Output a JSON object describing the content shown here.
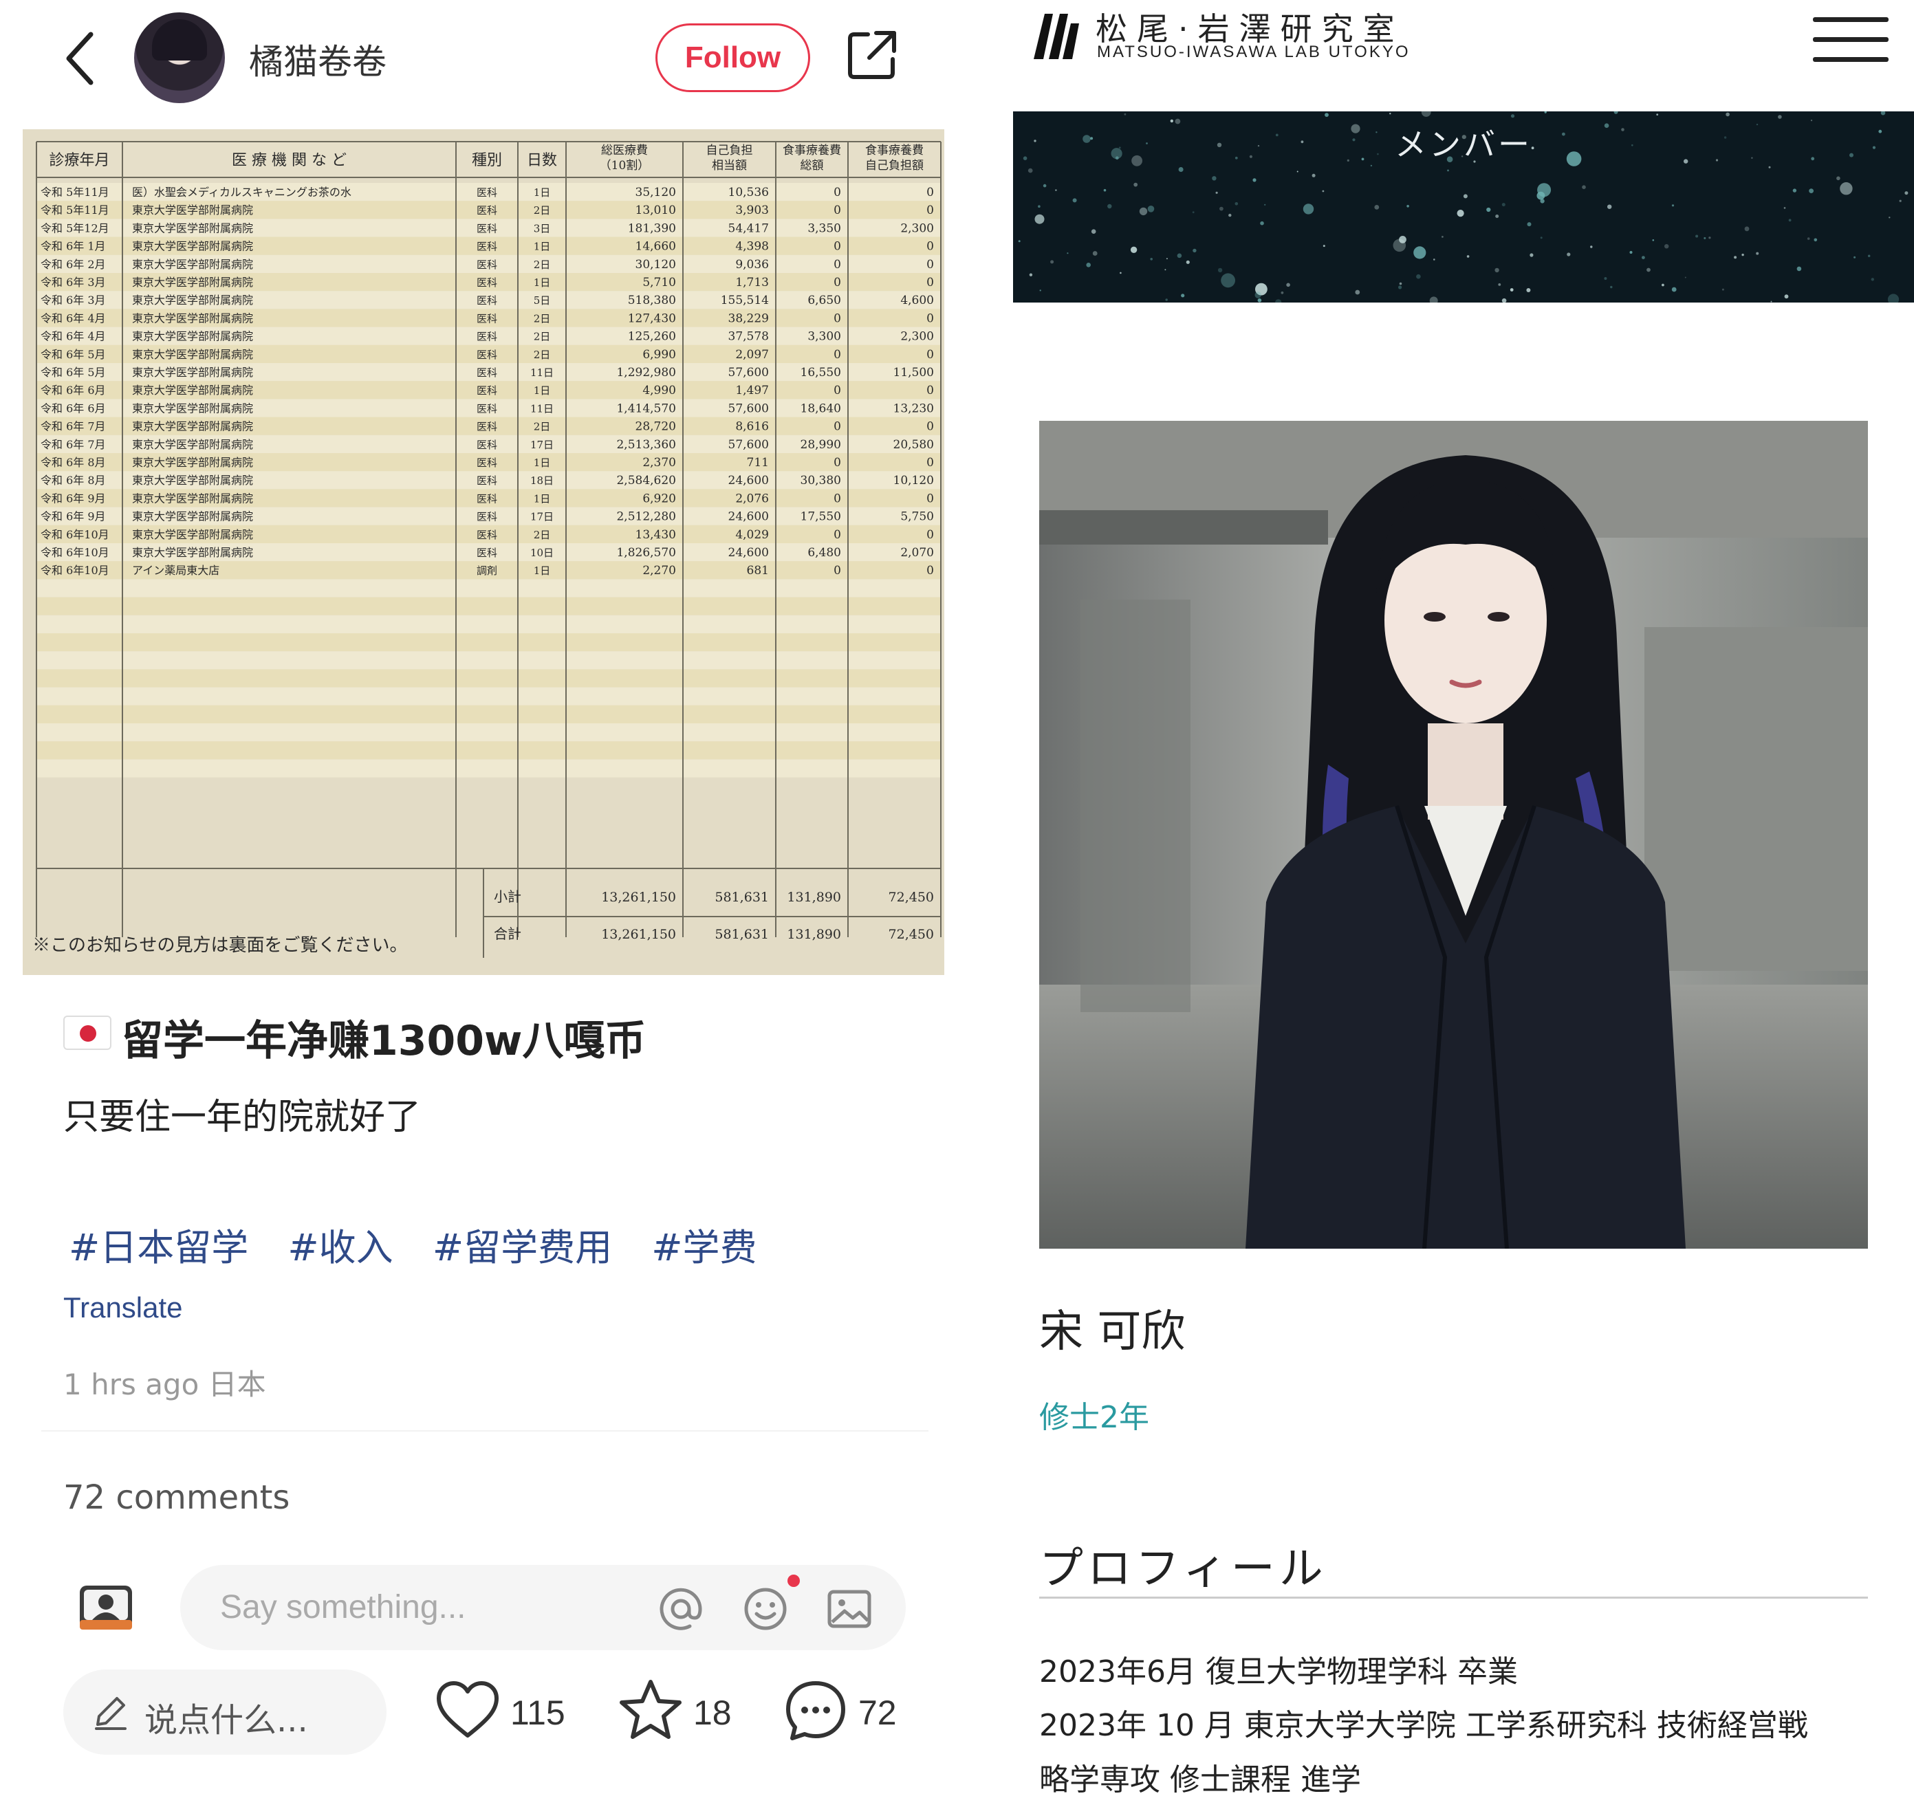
{
  "post": {
    "username": "橘猫卷卷",
    "follow_label": "Follow",
    "title": "留学一年净赚1300w八嘎币",
    "body": "只要住一年的院就好了",
    "tags": [
      "#日本留学",
      "#收入",
      "#留学费用",
      "#学费"
    ],
    "translate_label": "Translate",
    "time": "1 hrs ago 日本",
    "comments_count": "72 comments",
    "comment_placeholder": "Say something...",
    "write_placeholder": "说点什么...",
    "likes": "115",
    "stars": "18",
    "comments": "72"
  },
  "document": {
    "headers": [
      "診療年月",
      "医 療 機 関 な ど",
      "種別",
      "日数",
      "総医療費\n（10割）",
      "自己負担\n相当額",
      "食事療養費\n総額",
      "食事療養費\n自己負担額"
    ],
    "rows": [
      [
        "令和 5年11月",
        "医）水聖会メディカルスキャニングお茶の水",
        "医科",
        "1日",
        "35,120",
        "10,536",
        "0",
        "0"
      ],
      [
        "令和 5年11月",
        "東京大学医学部附属病院",
        "医科",
        "2日",
        "13,010",
        "3,903",
        "0",
        "0"
      ],
      [
        "令和 5年12月",
        "東京大学医学部附属病院",
        "医科",
        "3日",
        "181,390",
        "54,417",
        "3,350",
        "2,300"
      ],
      [
        "令和 6年 1月",
        "東京大学医学部附属病院",
        "医科",
        "1日",
        "14,660",
        "4,398",
        "0",
        "0"
      ],
      [
        "令和 6年 2月",
        "東京大学医学部附属病院",
        "医科",
        "2日",
        "30,120",
        "9,036",
        "0",
        "0"
      ],
      [
        "令和 6年 3月",
        "東京大学医学部附属病院",
        "医科",
        "1日",
        "5,710",
        "1,713",
        "0",
        "0"
      ],
      [
        "令和 6年 3月",
        "東京大学医学部附属病院",
        "医科",
        "5日",
        "518,380",
        "155,514",
        "6,650",
        "4,600"
      ],
      [
        "令和 6年 4月",
        "東京大学医学部附属病院",
        "医科",
        "2日",
        "127,430",
        "38,229",
        "0",
        "0"
      ],
      [
        "令和 6年 4月",
        "東京大学医学部附属病院",
        "医科",
        "2日",
        "125,260",
        "37,578",
        "3,300",
        "2,300"
      ],
      [
        "令和 6年 5月",
        "東京大学医学部附属病院",
        "医科",
        "2日",
        "6,990",
        "2,097",
        "0",
        "0"
      ],
      [
        "令和 6年 5月",
        "東京大学医学部附属病院",
        "医科",
        "11日",
        "1,292,980",
        "57,600",
        "16,550",
        "11,500"
      ],
      [
        "令和 6年 6月",
        "東京大学医学部附属病院",
        "医科",
        "1日",
        "4,990",
        "1,497",
        "0",
        "0"
      ],
      [
        "令和 6年 6月",
        "東京大学医学部附属病院",
        "医科",
        "11日",
        "1,414,570",
        "57,600",
        "18,640",
        "13,230"
      ],
      [
        "令和 6年 7月",
        "東京大学医学部附属病院",
        "医科",
        "2日",
        "28,720",
        "8,616",
        "0",
        "0"
      ],
      [
        "令和 6年 7月",
        "東京大学医学部附属病院",
        "医科",
        "17日",
        "2,513,360",
        "57,600",
        "28,990",
        "20,580"
      ],
      [
        "令和 6年 8月",
        "東京大学医学部附属病院",
        "医科",
        "1日",
        "2,370",
        "711",
        "0",
        "0"
      ],
      [
        "令和 6年 8月",
        "東京大学医学部附属病院",
        "医科",
        "18日",
        "2,584,620",
        "24,600",
        "30,380",
        "10,120"
      ],
      [
        "令和 6年 9月",
        "東京大学医学部附属病院",
        "医科",
        "1日",
        "6,920",
        "2,076",
        "0",
        "0"
      ],
      [
        "令和 6年 9月",
        "東京大学医学部附属病院",
        "医科",
        "17日",
        "2,512,280",
        "24,600",
        "17,550",
        "5,750"
      ],
      [
        "令和 6年10月",
        "東京大学医学部附属病院",
        "医科",
        "2日",
        "13,430",
        "4,029",
        "0",
        "0"
      ],
      [
        "令和 6年10月",
        "東京大学医学部附属病院",
        "医科",
        "10日",
        "1,826,570",
        "24,600",
        "6,480",
        "2,070"
      ],
      [
        "令和 6年10月",
        "アイン薬局東大店",
        "調剤",
        "1日",
        "2,270",
        "681",
        "0",
        "0"
      ]
    ],
    "subtotal": [
      "小計",
      "13,261,150",
      "581,631",
      "131,890",
      "72,450"
    ],
    "total": [
      "合計",
      "13,261,150",
      "581,631",
      "131,890",
      "72,450"
    ],
    "footnote": "※このお知らせの見方は裏面をご覧ください。"
  },
  "lab": {
    "name_jp": "松尾·岩澤研究室",
    "name_en": "MATSUO-IWASAWA LAB UTOKYO",
    "banner_title": "メンバー",
    "member_name": "宋 可欣",
    "member_grade": "修士2年",
    "profile_heading": "プロフィール",
    "profile_lines": [
      "2023年6月 復旦大学物理学科 卒業",
      "2023年 10 月 東京大学大学院 工学系研究科 技術経営戦",
      "略学専攻 修士課程 進学"
    ]
  },
  "colors": {
    "follow": "#e8364c",
    "tag": "#2f4a88",
    "grade": "#2a9aa0",
    "banner": "#0c1920"
  }
}
